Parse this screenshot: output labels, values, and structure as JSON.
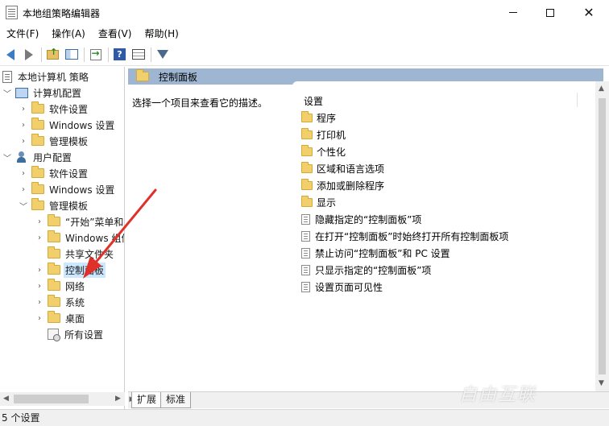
{
  "window": {
    "title": "本地组策略编辑器"
  },
  "menu": [
    "文件(F)",
    "操作(A)",
    "查看(V)",
    "帮助(H)"
  ],
  "tree": {
    "root": "本地计算机 策略",
    "computer_config": "计算机配置",
    "software_settings_1": "软件设置",
    "windows_settings_1": "Windows 设置",
    "admin_templates_1": "管理模板",
    "user_config": "用户配置",
    "software_settings_2": "软件设置",
    "windows_settings_2": "Windows 设置",
    "admin_templates_2": "管理模板",
    "start_menu": "“开始”菜单和",
    "windows_components": "Windows 组件",
    "shared_folders": "共享文件夹",
    "control_panel": "控制面板",
    "network": "网络",
    "system": "系统",
    "desktop": "桌面",
    "all_settings": "所有设置"
  },
  "header": {
    "title": "控制面板"
  },
  "description": "选择一个项目来查看它的描述。",
  "list": {
    "column": "设置",
    "items": [
      {
        "type": "folder",
        "label": "程序"
      },
      {
        "type": "folder",
        "label": "打印机"
      },
      {
        "type": "folder",
        "label": "个性化"
      },
      {
        "type": "folder",
        "label": "区域和语言选项"
      },
      {
        "type": "folder",
        "label": "添加或删除程序"
      },
      {
        "type": "folder",
        "label": "显示"
      },
      {
        "type": "policy",
        "label": "隐藏指定的“控制面板”项"
      },
      {
        "type": "policy",
        "label": "在打开“控制面板”时始终打开所有控制面板项"
      },
      {
        "type": "policy",
        "label": "禁止访问“控制面板”和 PC 设置"
      },
      {
        "type": "policy",
        "label": "只显示指定的“控制面板”项"
      },
      {
        "type": "policy",
        "label": "设置页面可见性"
      }
    ]
  },
  "tabs": [
    "扩展",
    "标准"
  ],
  "status": "5 个设置",
  "watermark": "自由互联",
  "colors": {
    "header_band": "#9eb6d1",
    "selection": "#cce8ff",
    "arrow": "#e0302a"
  }
}
